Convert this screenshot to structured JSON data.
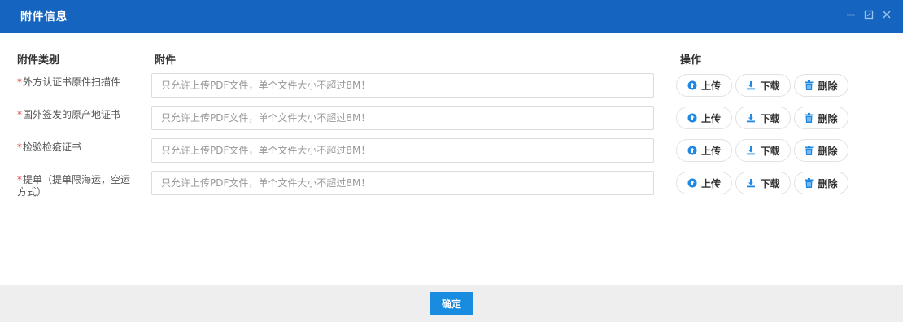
{
  "dialog": {
    "title": "附件信息",
    "controls": [
      "minimize-icon",
      "maximize-icon",
      "close-icon"
    ]
  },
  "table": {
    "headers": {
      "category": "附件类别",
      "attachment": "附件",
      "operation": "操作"
    },
    "required_mark": "*",
    "rows": [
      {
        "category": "外方认证书原件扫描件",
        "placeholder": "只允许上传PDF文件，单个文件大小不超过8M！"
      },
      {
        "category": "国外签发的原产地证书",
        "placeholder": "只允许上传PDF文件，单个文件大小不超过8M！"
      },
      {
        "category": "检验检疫证书",
        "placeholder": "只允许上传PDF文件，单个文件大小不超过8M！"
      },
      {
        "category": "提单（提单限海运，空运方式）",
        "placeholder": "只允许上传PDF文件，单个文件大小不超过8M！"
      }
    ],
    "actions": {
      "upload": "上传",
      "download": "下载",
      "delete": "删除"
    }
  },
  "footer": {
    "confirm_label": "确定"
  },
  "colors": {
    "titlebar": "#1565c0",
    "confirm_button": "#1a8ce0",
    "required": "#e53935",
    "icon_blue": "#1e88e5"
  }
}
